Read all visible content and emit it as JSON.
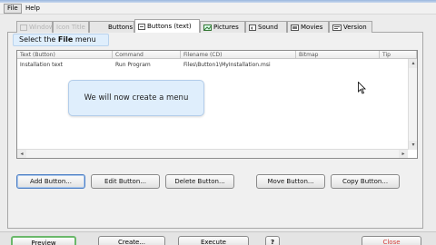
{
  "menu": {
    "file": "File",
    "help": "Help"
  },
  "tabs": [
    {
      "label": "Window",
      "icon": "window-icon",
      "faded": true
    },
    {
      "label": "Icon Title",
      "icon": "title-icon",
      "faded": true
    },
    {
      "label": "Buttons",
      "icon": "buttons-icon",
      "faded": false
    },
    {
      "label": "Buttons (text)",
      "icon": "buttons-text-icon",
      "faded": false,
      "active": true
    },
    {
      "label": "Pictures",
      "icon": "pictures-icon",
      "faded": false
    },
    {
      "label": "Sound",
      "icon": "sound-icon",
      "faded": false
    },
    {
      "label": "Movies",
      "icon": "movies-icon",
      "faded": false
    },
    {
      "label": "Version",
      "icon": "version-icon",
      "faded": false
    }
  ],
  "list": {
    "columns": [
      "Text (Button)",
      "Command",
      "Filename (CD)",
      "Bitmap",
      "Tip"
    ],
    "rows": [
      [
        "Installation text",
        "Run Program",
        "Files\\Button1\\MyInstallation.msi",
        "",
        ""
      ]
    ]
  },
  "buttons": {
    "add": "Add Button...",
    "edit": "Edit Button...",
    "delete": "Delete Button...",
    "move": "Move Button...",
    "copy": "Copy Button..."
  },
  "bottom": {
    "preview": "Preview",
    "create": "Create...",
    "execute": "Execute",
    "help": "?",
    "close": "Close"
  },
  "tooltips": {
    "select_prefix": "Select the ",
    "select_bold": "File",
    "select_suffix": " menu",
    "create_menu": "We will now create a menu"
  },
  "colors": {
    "tooltip_bg": "#dfeefc",
    "preview_border": "#6ab86a",
    "close_text": "#d43f3a"
  }
}
